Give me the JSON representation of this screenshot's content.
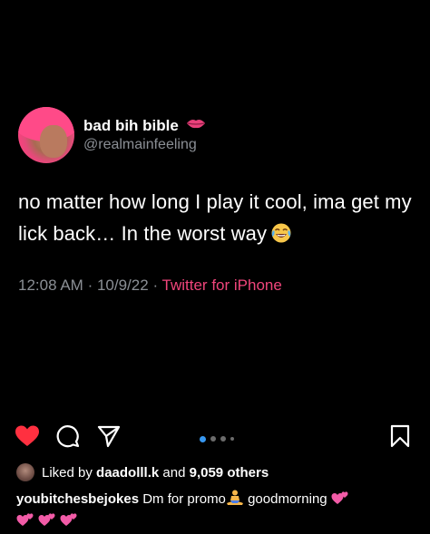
{
  "tweet": {
    "author_name": "bad bih bible",
    "author_name_emoji": "lips-icon",
    "handle": "@realmainfeeling",
    "text": "no matter how long I play it cool, ima get my lick back… In the worst way",
    "text_emoji": "tears-of-joy-icon",
    "time": "12:08 AM",
    "separator": "·",
    "date": "10/9/22",
    "source": "Twitter for iPhone",
    "source_color": "#f0457b"
  },
  "post": {
    "actions": [
      "heart-icon",
      "comment-icon",
      "share-icon",
      "bookmark-icon"
    ],
    "like_color": "#ff3040",
    "carousel": {
      "count": 4,
      "active": 1,
      "active_color": "#3797f0"
    },
    "likes_prefix": "Liked by",
    "likes_user": "daadolll.k",
    "likes_and": "and",
    "likes_others": "9,059 others",
    "caption_user": "youbitchesbejokes",
    "caption_text": "Dm for promo",
    "caption_text_2": "goodmorning",
    "caption_emojis": [
      "meditation-icon",
      "two-hearts-icon",
      "two-hearts-icon",
      "two-hearts-icon",
      "two-hearts-icon"
    ]
  }
}
